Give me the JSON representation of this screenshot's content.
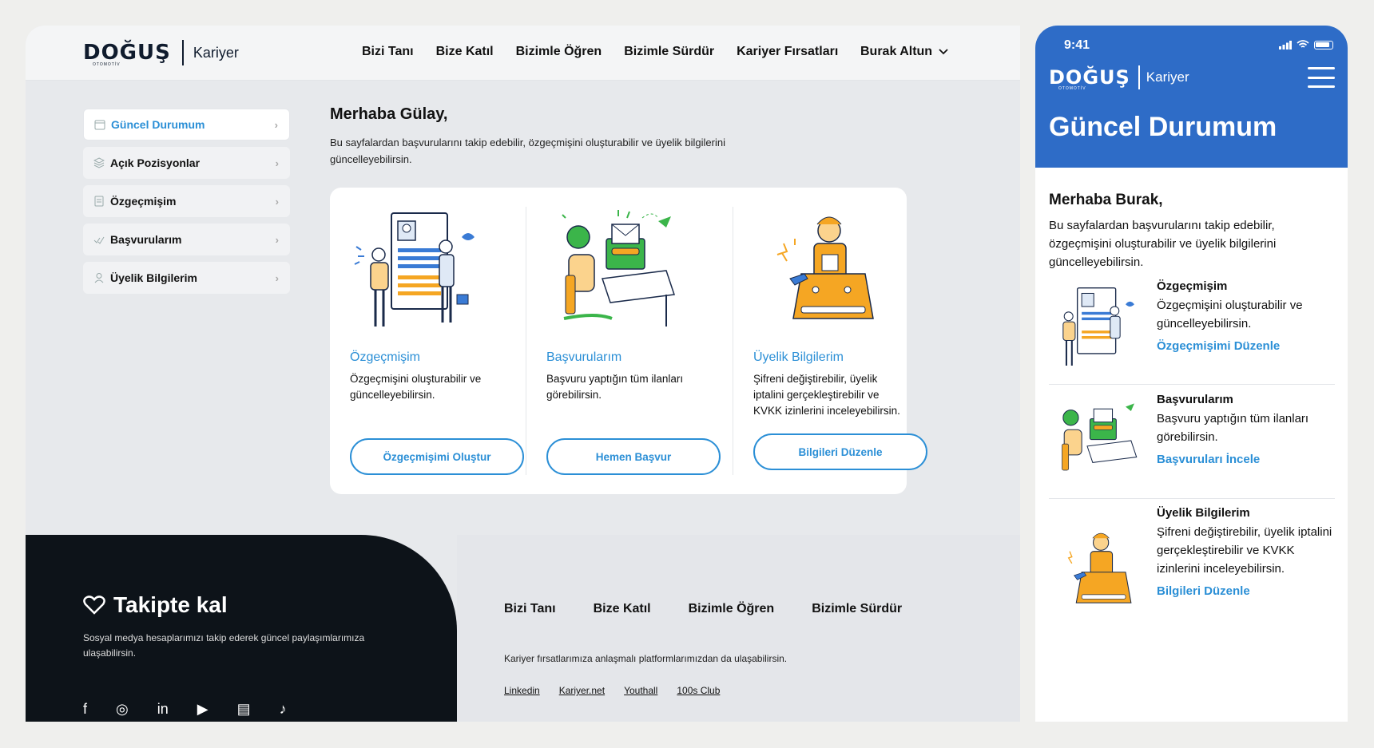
{
  "brand": {
    "logo": "DOĞUŞ",
    "logo_sub": "OTOMOTİV",
    "career": "Kariyer"
  },
  "desktop": {
    "nav": [
      "Bizi Tanı",
      "Bize Katıl",
      "Bizimle Öğren",
      "Bizimle Sürdür",
      "Kariyer Fırsatları"
    ],
    "user": "Burak Altun",
    "sidebar": [
      {
        "label": "Güncel Durumum",
        "icon": "calendar-icon"
      },
      {
        "label": "Açık Pozisyonlar",
        "icon": "layers-icon"
      },
      {
        "label": "Özgeçmişim",
        "icon": "document-icon"
      },
      {
        "label": "Başvurularım",
        "icon": "check-icon"
      },
      {
        "label": "Üyelik Bilgilerim",
        "icon": "user-icon"
      }
    ],
    "greeting": "Merhaba Gülay,",
    "greeting_sub": "Bu sayfalardan başvurularını takip edebilir, özgeçmişini oluşturabilir ve üyelik bilgilerini güncelleyebilirsin.",
    "cards": [
      {
        "title": "Özgeçmişim",
        "desc": "Özgeçmişini oluşturabilir ve güncelleyebilirsin.",
        "button": "Özgeçmişimi Oluştur"
      },
      {
        "title": "Başvurularım",
        "desc": "Başvuru yaptığın tüm ilanları görebilirsin.",
        "button": "Hemen Başvur"
      },
      {
        "title": "Üyelik Bilgilerim",
        "desc": "Şifreni değiştirebilir, üyelik iptalini gerçekleştirebilir ve KVKK izinlerini inceleyebilirsin.",
        "button": "Bilgileri Düzenle"
      }
    ],
    "footer": {
      "follow_title": "Takipte kal",
      "follow_sub": "Sosyal medya hesaplarımızı takip ederek güncel paylaşımlarımıza ulaşabilirsin.",
      "nav": [
        "Bizi Tanı",
        "Bize Katıl",
        "Bizimle Öğren",
        "Bizimle Sürdür"
      ],
      "platforms_text": "Kariyer fırsatlarımıza anlaşmalı platformlarımızdan da ulaşabilirsin.",
      "platforms": [
        "Linkedin",
        "Kariyer.net",
        "Youthall",
        "100s Club"
      ]
    }
  },
  "mobile": {
    "time": "9:41",
    "title": "Güncel Durumum",
    "greeting": "Merhaba Burak,",
    "greeting_sub": "Bu sayfalardan başvurularını takip edebilir, özgeçmişini oluşturabilir ve üyelik bilgilerini güncelleyebilirsin.",
    "items": [
      {
        "title": "Özgeçmişim",
        "desc": "Özgeçmişini oluşturabilir ve güncelleyebilirsin.",
        "link": "Özgeçmişimi Düzenle"
      },
      {
        "title": "Başvurularım",
        "desc": "Başvuru yaptığın tüm ilanları görebilirsin.",
        "link": "Başvuruları İncele"
      },
      {
        "title": "Üyelik Bilgilerim",
        "desc": "Şifreni değiştirebilir, üyelik iptalini gerçekleştirebilir ve KVKK izinlerini inceleyebilirsin.",
        "link": "Bilgileri Düzenle"
      }
    ]
  },
  "colors": {
    "accent": "#2b8fd6",
    "mobile_header": "#2e6cc7",
    "footer_dark": "#0d1319",
    "illustration_orange": "#f5a623",
    "illustration_blue": "#3a7bd5",
    "illustration_green": "#3bb54a"
  }
}
